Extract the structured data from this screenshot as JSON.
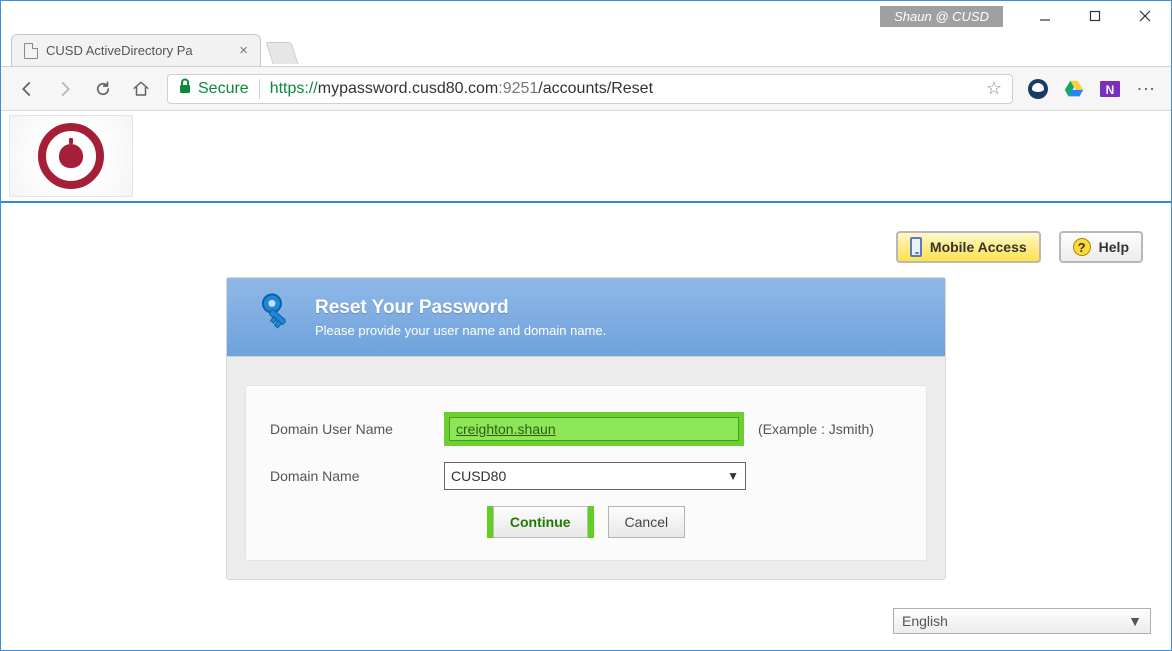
{
  "window": {
    "user_badge": "Shaun @ CUSD"
  },
  "tab": {
    "title": "CUSD ActiveDirectory Pa"
  },
  "address_bar": {
    "secure_label": "Secure",
    "url_protocol": "https://",
    "url_host": "mypassword.cusd80.com",
    "url_port": ":9251",
    "url_path": "/accounts/Reset"
  },
  "top_buttons": {
    "mobile_access": "Mobile Access",
    "help": "Help"
  },
  "panel": {
    "title": "Reset Your Password",
    "subtitle": "Please provide your user name and domain name."
  },
  "form": {
    "username_label": "Domain User Name",
    "username_value": "creighton.shaun",
    "username_example": "(Example : Jsmith)",
    "domain_label": "Domain Name",
    "domain_value": "CUSD80",
    "continue_label": "Continue",
    "cancel_label": "Cancel"
  },
  "language": {
    "selected": "English"
  }
}
